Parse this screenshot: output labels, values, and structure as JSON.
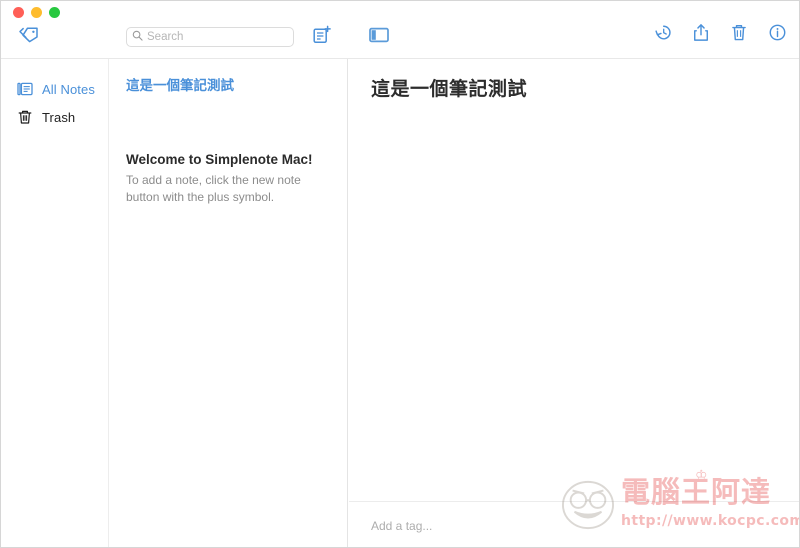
{
  "window": {
    "traffic_lights": [
      {
        "name": "close",
        "color": "#ff5f57"
      },
      {
        "name": "minimize",
        "color": "#febc2e"
      },
      {
        "name": "zoom",
        "color": "#28c840"
      }
    ]
  },
  "toolbar": {
    "tag_icon": "tag-icon",
    "search": {
      "placeholder": "Search",
      "value": "",
      "icon": "search-icon"
    },
    "new_note_icon": "new-note-icon",
    "panel_toggle_icon": "sidebar-toggle-icon",
    "actions": [
      {
        "name": "history-icon",
        "label": "History"
      },
      {
        "name": "share-icon",
        "label": "Share"
      },
      {
        "name": "trash-icon",
        "label": "Trash"
      },
      {
        "name": "info-icon",
        "label": "Info"
      }
    ]
  },
  "sidebar": {
    "items": [
      {
        "label": "All Notes",
        "icon": "all-notes-icon",
        "active": true
      },
      {
        "label": "Trash",
        "icon": "trash-icon",
        "active": false
      }
    ],
    "accent_color": "#4a90d9"
  },
  "note_list": {
    "notes": [
      {
        "title": "這是一個筆記測試",
        "preview": "",
        "selected": true
      },
      {
        "title": "Welcome to Simplenote Mac!",
        "preview": "To add a note, click the new note button with the plus symbol.",
        "selected": false
      }
    ]
  },
  "editor": {
    "title": "這是一個筆記測試",
    "body": "",
    "tag_placeholder": "Add a tag...",
    "tag_value": ""
  },
  "watermark": {
    "brand": "電腦王阿達",
    "url": "http://www.kocpc.com.tw",
    "crown": "♔",
    "color": "#e02020"
  }
}
